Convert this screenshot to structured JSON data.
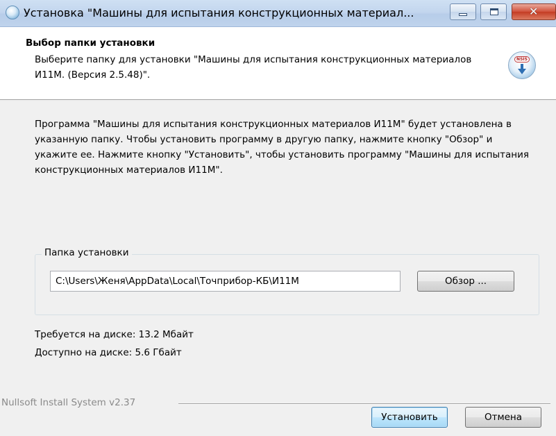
{
  "window": {
    "title": "Установка \"Машины для испытания конструкционных материал...",
    "min_glyph": "",
    "max_glyph": "",
    "close_glyph": "✕"
  },
  "header": {
    "title": "Выбор папки установки",
    "subtitle": "Выберите папку для установки \"Машины для испытания конструкционных материалов И11М. (Версия 2.5.48)\".",
    "icon_badge": "NSIS"
  },
  "body": {
    "description": "Программа \"Машины для испытания конструкционных материалов И11М\" будет установлена в указанную папку. Чтобы установить программу в другую папку, нажмите кнопку \"Обзор\" и укажите ее. Нажмите кнопку \"Установить\", чтобы установить программу \"Машины для испытания конструкционных материалов И11М\".",
    "group_label": "Папка установки",
    "install_path": "C:\\Users\\Женя\\AppData\\Local\\Точприбор-КБ\\И11М",
    "browse_label": "Обзор ...",
    "space_required": "Требуется на диске: 13.2 Мбайт",
    "space_available": "Доступно на диске: 5.6 Гбайт"
  },
  "footer": {
    "branding": "Nullsoft Install System v2.37",
    "install_label": "Установить",
    "cancel_label": "Отмена"
  },
  "icons": [
    "installer-app-icon",
    "minimize-icon",
    "maximize-icon",
    "close-icon",
    "nsis-setup-icon"
  ],
  "colors": {
    "titlebar": "#c3d6ee",
    "header_bg": "#ffffff",
    "body_bg": "#f0f0f0",
    "close_button": "#c43c24",
    "default_button_border": "#3c7fb1"
  }
}
